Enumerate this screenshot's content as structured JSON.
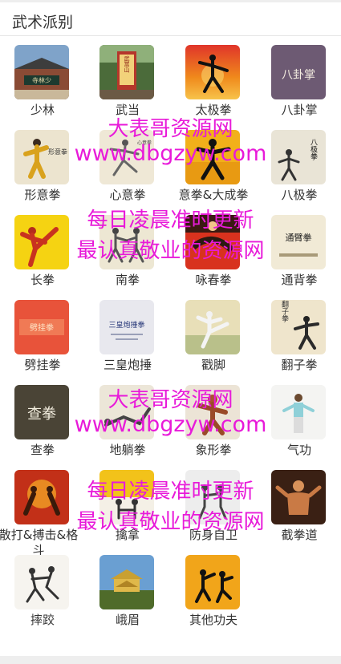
{
  "header": {
    "title": "武术派别"
  },
  "items": [
    {
      "label": "少林",
      "icon": "shaolin-temple-icon"
    },
    {
      "label": "武当",
      "icon": "wudang-gate-icon"
    },
    {
      "label": "太极拳",
      "icon": "taiji-silhouette-icon"
    },
    {
      "label": "八卦掌",
      "icon": "bagua-calligraphy-icon"
    },
    {
      "label": "形意拳",
      "icon": "xingyi-figure-icon"
    },
    {
      "label": "心意拳",
      "icon": "xinyi-figure-icon"
    },
    {
      "label": "意拳&大成拳",
      "icon": "yiquan-figure-icon"
    },
    {
      "label": "八极拳",
      "icon": "baji-calligraphy-icon"
    },
    {
      "label": "长拳",
      "icon": "changquan-kick-icon"
    },
    {
      "label": "南拳",
      "icon": "nanquan-fighters-icon"
    },
    {
      "label": "咏春拳",
      "icon": "wingchun-icon"
    },
    {
      "label": "通背拳",
      "icon": "tongbei-calligraphy-icon"
    },
    {
      "label": "劈挂拳",
      "icon": "piguaquan-icon"
    },
    {
      "label": "三皇炮捶",
      "icon": "sanhuang-book-icon"
    },
    {
      "label": "戳脚",
      "icon": "chuojiao-kick-icon"
    },
    {
      "label": "翻子拳",
      "icon": "fanziquan-icon"
    },
    {
      "label": "查拳",
      "icon": "chaquan-calligraphy-icon"
    },
    {
      "label": "地躺拳",
      "icon": "ditangquan-icon"
    },
    {
      "label": "象形拳",
      "icon": "xiangxing-icon"
    },
    {
      "label": "气功",
      "icon": "qigong-figure-icon"
    },
    {
      "label": "散打&搏击&格斗",
      "icon": "sanda-boxing-icon"
    },
    {
      "label": "擒拿",
      "icon": "qinna-icon"
    },
    {
      "label": "防身自卫",
      "icon": "self-defense-icon"
    },
    {
      "label": "截拳道",
      "icon": "jeet-kune-do-icon"
    },
    {
      "label": "摔跤",
      "icon": "wrestling-icon"
    },
    {
      "label": "峨眉",
      "icon": "emei-temple-icon"
    },
    {
      "label": "其他功夫",
      "icon": "other-kungfu-icon"
    }
  ],
  "watermarks": [
    "大表哥资源网",
    "www.dbgzyw.com",
    "每日凌晨准时更新",
    "最认真敬业的资源网",
    "大表哥资源网",
    "www.dbgzyw.com",
    "每日凌晨准时更新",
    "最认真敬业的资源网"
  ],
  "thumb_texts": {
    "shaolin": "寺林少",
    "wudang": "武當山",
    "bagua": "八卦掌",
    "xingyi": "形意拳",
    "baji": "八极拳",
    "tongbei": "通臂拳",
    "pigua": "劈挂拳",
    "sanhuang": "三皇炮捶拳",
    "fanzi": "翻子拳",
    "chaquan": "查拳",
    "xinyi": "心意拳"
  },
  "colors": {
    "watermark": "#e81ad9",
    "text": "#333333",
    "divider": "#e6e6e6"
  }
}
